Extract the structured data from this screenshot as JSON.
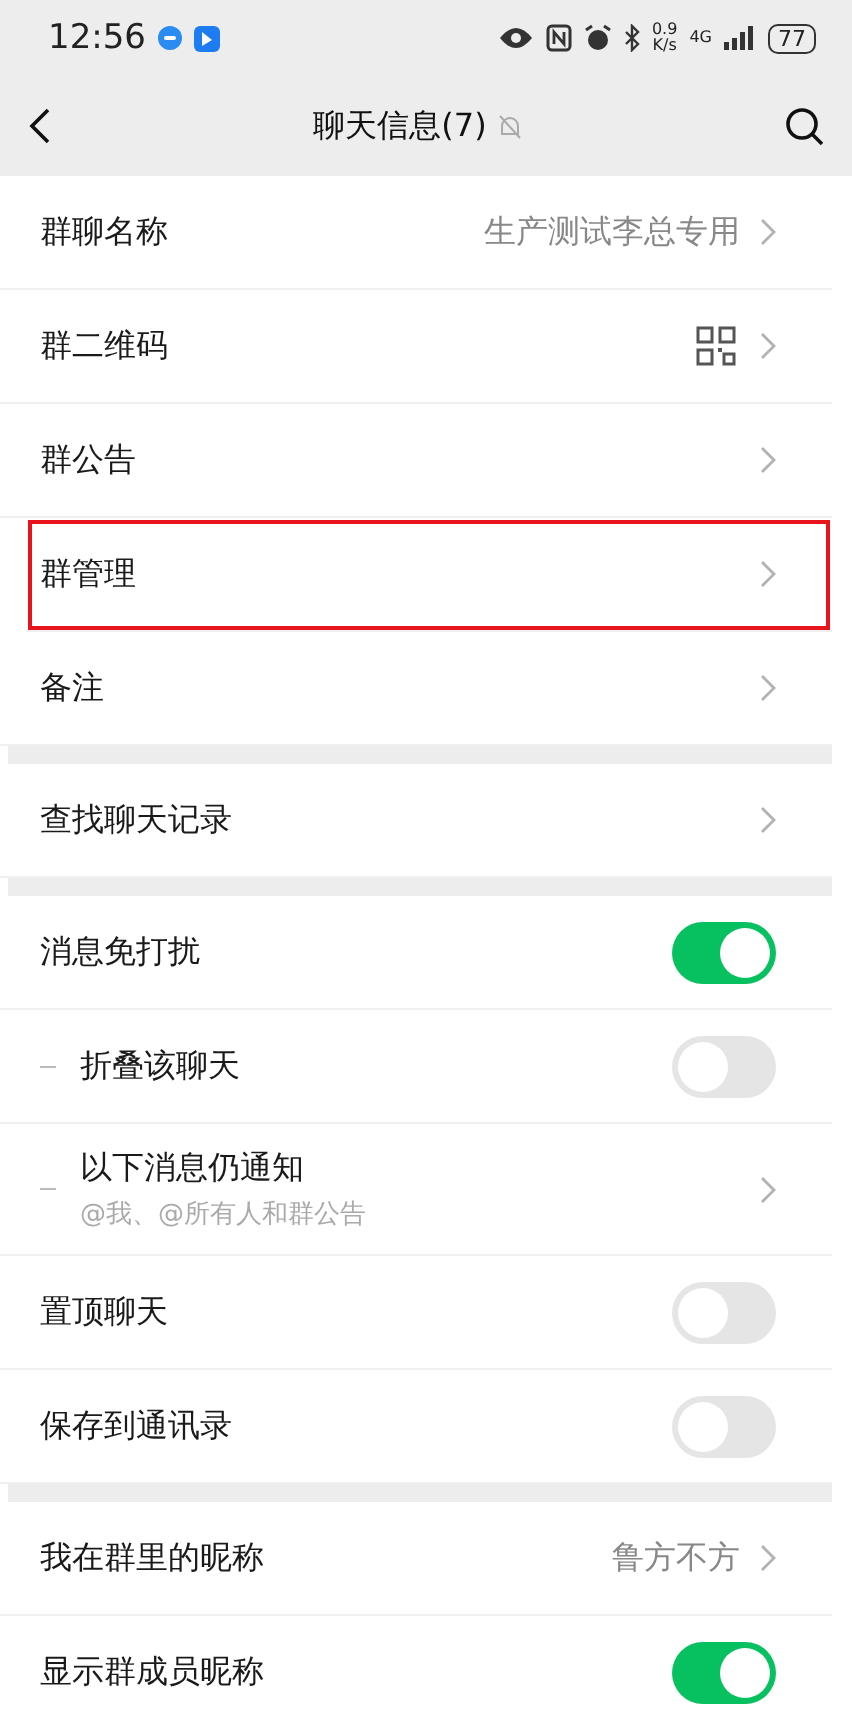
{
  "status_bar": {
    "time": "12:56",
    "speed_value": "0.9",
    "speed_unit": "K/s",
    "network": "4G",
    "battery": "77"
  },
  "header": {
    "title": "聊天信息(7)",
    "muted": true
  },
  "sections": [
    {
      "rows": [
        {
          "kind": "link",
          "label": "群聊名称",
          "value": "生产测试李总专用",
          "highlighted": false
        },
        {
          "kind": "qr",
          "label": "群二维码",
          "highlighted": false
        },
        {
          "kind": "link",
          "label": "群公告",
          "highlighted": false
        },
        {
          "kind": "link",
          "label": "群管理",
          "highlighted": true
        },
        {
          "kind": "link",
          "label": "备注",
          "highlighted": false
        }
      ]
    },
    {
      "rows": [
        {
          "kind": "link",
          "label": "查找聊天记录",
          "highlighted": false
        }
      ]
    },
    {
      "rows": [
        {
          "kind": "toggle",
          "label": "消息免打扰",
          "on": true,
          "highlighted": false
        },
        {
          "kind": "sub_toggle",
          "label": "折叠该聊天",
          "on": false,
          "highlighted": false
        },
        {
          "kind": "sub_link",
          "label": "以下消息仍通知",
          "note": "@我、@所有人和群公告",
          "highlighted": false
        },
        {
          "kind": "toggle",
          "label": "置顶聊天",
          "on": false,
          "highlighted": false
        },
        {
          "kind": "toggle",
          "label": "保存到通讯录",
          "on": false,
          "highlighted": false
        }
      ]
    },
    {
      "rows": [
        {
          "kind": "link",
          "label": "我在群里的昵称",
          "value": "鲁方不方",
          "highlighted": false
        },
        {
          "kind": "toggle",
          "label": "显示群成员昵称",
          "on": true,
          "highlighted": false
        }
      ]
    }
  ]
}
